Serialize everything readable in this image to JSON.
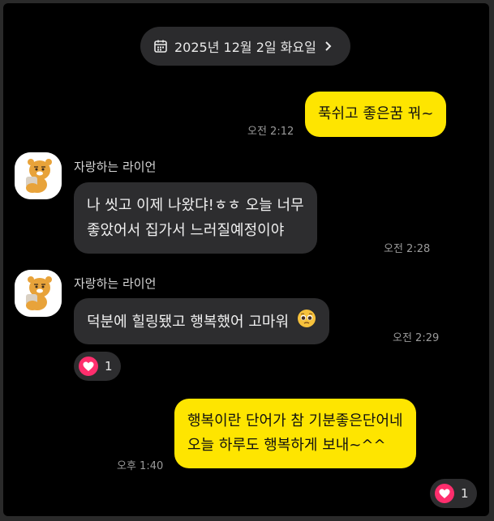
{
  "date_divider": {
    "label": "2025년 12월 2일 화요일"
  },
  "messages": [
    {
      "from": "me",
      "text": "푹쉬고 좋은꿈 꿔~",
      "time": "오전 2:12"
    },
    {
      "from": "them",
      "sender": "자랑하는 라이언",
      "lines": [
        "나 씻고 이제 나왔댜!ㅎㅎ 오늘 너무",
        "좋았어서 집가서 느러질예정이야"
      ],
      "time": "오전 2:28"
    },
    {
      "from": "them",
      "sender": "자랑하는 라이언",
      "text": "덕분에 힐링됐고 행복했어 고마워",
      "emoji": "pleading-face-emoji",
      "time": "오전 2:29",
      "reaction": {
        "icon": "heart-icon",
        "count": "1"
      }
    },
    {
      "from": "me",
      "lines": [
        "행복이란 단어가 참 기분좋은단어네",
        "오늘 하루도 행복하게 보내~^^"
      ],
      "time": "오후 1:40",
      "reaction": {
        "icon": "heart-icon",
        "count": "1"
      }
    }
  ],
  "colors": {
    "background": "#000000",
    "my_bubble": "#fee500",
    "their_bubble": "#2d2d2f",
    "heart": "#ff2e6d"
  }
}
